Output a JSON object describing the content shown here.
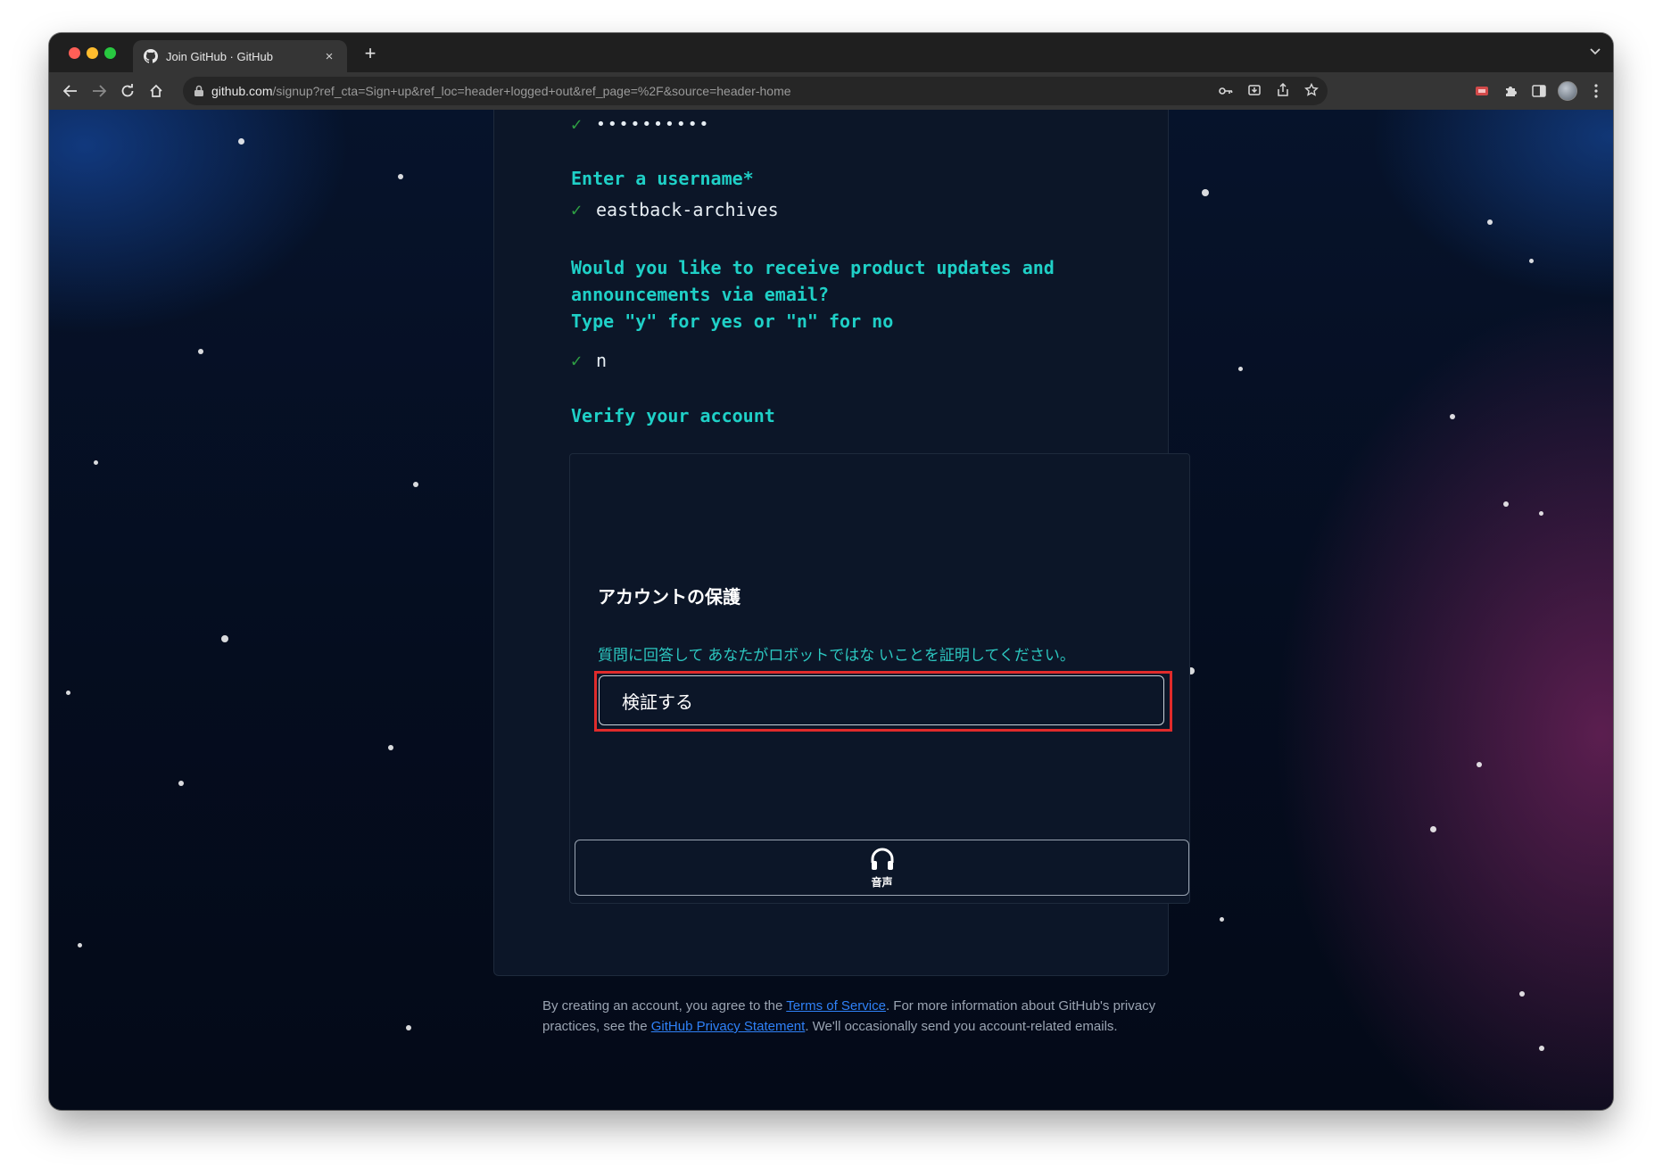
{
  "browser": {
    "tab_title": "Join GitHub · GitHub",
    "tab_close": "×",
    "new_tab": "+",
    "url_host": "github.com",
    "url_path": "/signup?ref_cta=Sign+up&ref_loc=header+logged+out&ref_page=%2F&source=header-home"
  },
  "signup": {
    "password_mask": "••••••••••",
    "username_prompt": "Enter a username*",
    "username_value": "eastback-archives",
    "email_prompt_line1": "Would you like to receive product updates and",
    "email_prompt_line2": "announcements via email?",
    "email_prompt_line3": "Type \"y\" for yes or \"n\" for no",
    "email_value": "n",
    "verify_prompt": "Verify your account",
    "check_mark": "✓"
  },
  "captcha": {
    "title": "アカウントの保護",
    "description": "質問に回答して あなたがロボットではな いことを証明してください。",
    "verify_button": "検証する",
    "audio_label": "音声"
  },
  "footer": {
    "text_before_terms": "By creating an account, you agree to the ",
    "terms_link": "Terms of Service",
    "text_middle": ". For more information about GitHub's privacy practices, see the ",
    "privacy_link": "GitHub Privacy Statement",
    "text_after": ". We'll occasionally send you account-related emails."
  }
}
